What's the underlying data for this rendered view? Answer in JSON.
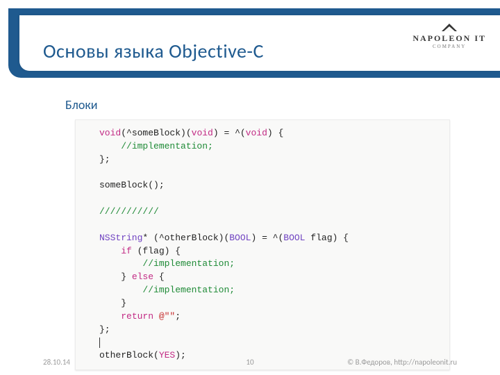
{
  "header": {
    "title": "Основы языка Objective-C",
    "logo": {
      "name": "NAPOLEON IT",
      "sub": "COMPANY"
    }
  },
  "bullet": {
    "marker": "",
    "text": "Блоки"
  },
  "code": {
    "l1_kw": "void",
    "l1_rest": "(^someBlock)(",
    "l1_kw2": "void",
    "l1_rest2": ") = ^(",
    "l1_kw3": "void",
    "l1_rest3": ") {",
    "l2_cmt": "//implementation;",
    "l3": "};",
    "l5": "someBlock();",
    "l7_cmt": "///////////",
    "l9_typ": "NSString",
    "l9_rest": "* (^otherBlock)(",
    "l9_typ2": "BOOL",
    "l9_rest2": ") = ^(",
    "l9_typ3": "BOOL",
    "l9_rest3": " flag) {",
    "l10_kw": "if",
    "l10_rest": " (flag) {",
    "l11_cmt": "//implementation;",
    "l12a": "} ",
    "l12_kw": "else",
    "l12b": " {",
    "l13_cmt": "//implementation;",
    "l14": "}",
    "l15_kw": "return",
    "l15_str": " @\"\"",
    "l15_end": ";",
    "l16": "};",
    "l18a": "otherBlock(",
    "l18_lit": "YES",
    "l18b": ");"
  },
  "footer": {
    "date": "28.10.14",
    "page": "10",
    "copyright": "© В.Федоров, http://napoleonit.ru"
  }
}
